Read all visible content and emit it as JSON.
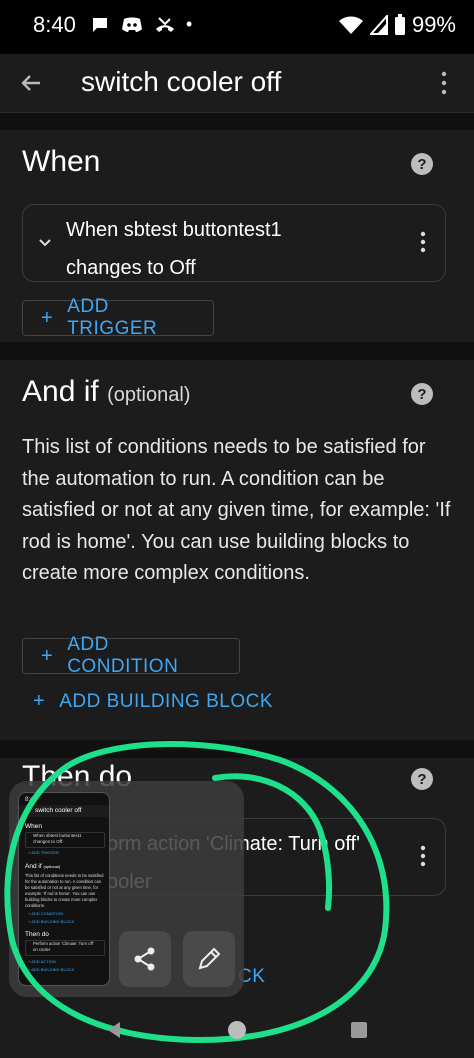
{
  "status_bar": {
    "time": "8:40",
    "battery": "99%",
    "dot": "•"
  },
  "app_bar": {
    "title": "switch cooler off"
  },
  "when": {
    "title": "When",
    "trigger_line1": "When sbtest buttontest1",
    "trigger_line2": "changes to Off",
    "add_trigger": "ADD TRIGGER"
  },
  "and_if": {
    "title": "And if",
    "optional": "(optional)",
    "description": "This list of conditions needs to be satisfied for the automation to run. A condition can be satisfied or not at any given time, for example: 'If rod is home'. You can use building blocks to create more complex conditions.",
    "add_condition": "ADD CONDITION",
    "add_building_block": "ADD BUILDING BLOCK"
  },
  "then_do": {
    "title": "Then do",
    "action_line1": "Perform action 'Climate: Turn off'",
    "action_line2": "on cooler",
    "visible_line1": "orm action 'Climate: Turn off'",
    "visible_line2": "ooler",
    "add_building_block_tail": "CK"
  },
  "thumbnail": {
    "time": "8:40",
    "title": "switch cooler off",
    "when": "When",
    "trigger_1": "When sbtest buttontest1",
    "trigger_2": "changes to Off",
    "add_trigger": "+ ADD TRIGGER",
    "and_if": "And if",
    "optional": "(optional)",
    "desc": "This list of conditions needs to be satisfied for the automation to run. A condition can be satisfied or not at any given time, for example: 'If rod is home'. You can use building blocks to create more complex conditions.",
    "add_condition": "+ ADD CONDITION",
    "add_building_block": "+ ADD BUILDING BLOCK",
    "then_do": "Then do",
    "action_1": "Perform action 'Climate: Turn off'",
    "action_2": "on cooler",
    "add_action": "+ ADD ACTION",
    "add_building_block_2": "+ ADD BUILDING BLOCK"
  },
  "colors": {
    "accent": "#3fa7f3",
    "card": "#1c1c1c",
    "annotation": "#1ee08a"
  },
  "icons": [
    "back-arrow-icon",
    "overflow-menu-icon",
    "help-icon",
    "chevron-down-icon",
    "more-vert-icon",
    "share-icon",
    "edit-icon",
    "nav-back-icon",
    "nav-home-icon",
    "nav-recents-icon"
  ]
}
